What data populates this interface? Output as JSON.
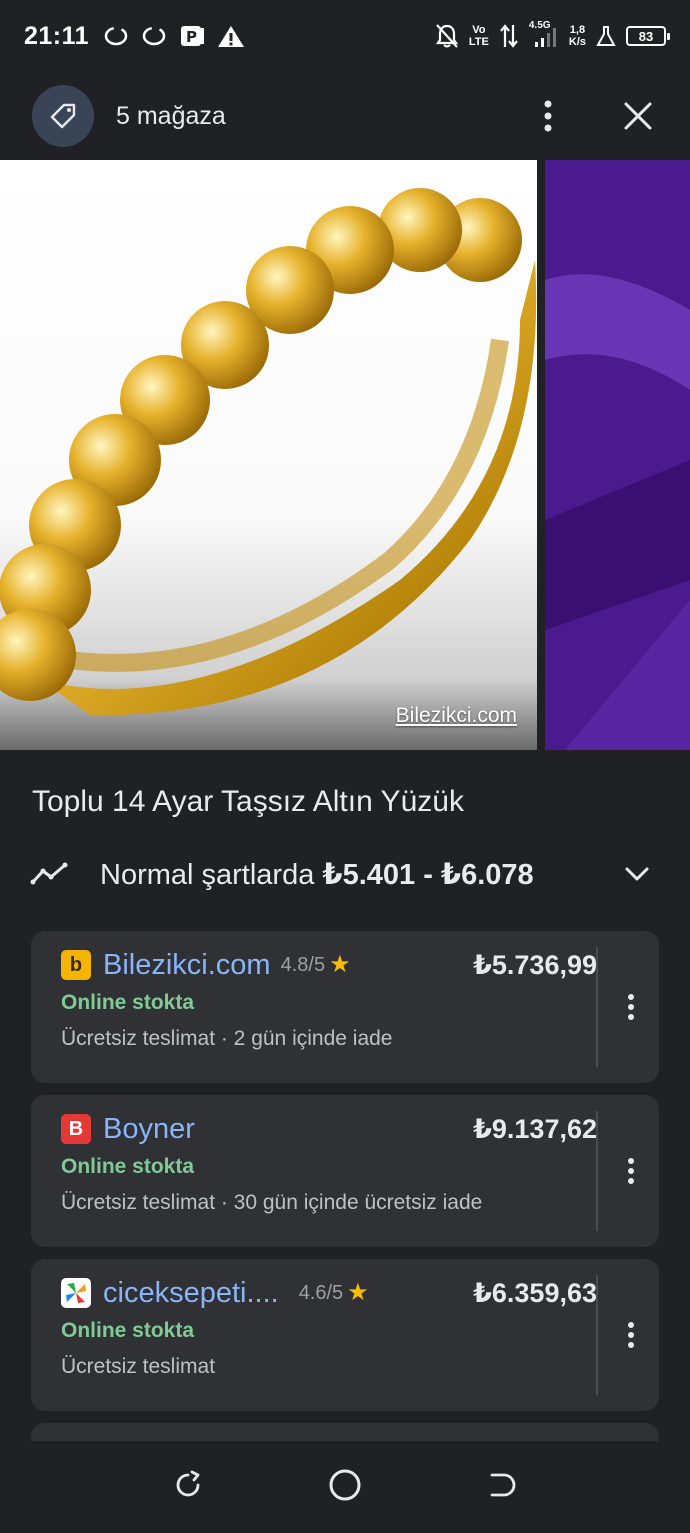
{
  "status_bar": {
    "time": "21:11",
    "net_type_top": "Vo",
    "net_type_bottom": "LTE",
    "signal_label": "4.5G",
    "speed_top": "1,8",
    "speed_bottom": "K/s",
    "battery": "83"
  },
  "header": {
    "title": "5 mağaza"
  },
  "gallery": {
    "source": "Bilezikci.com"
  },
  "product": {
    "title": "Toplu 14 Ayar Taşsız Altın Yüzük",
    "price_prefix": "Normal şartlarda",
    "price_range": "₺5.401 - ₺6.078"
  },
  "offers": [
    {
      "logo_letter": "b",
      "logo_bg": "#f4b400",
      "logo_fg": "#3c2a00",
      "store": "Bilezikci.com",
      "rating": "4.8/5",
      "price": "₺5.736,99",
      "stock": "Online stokta",
      "delivery": "Ücretsiz teslimat · 2 gün içinde iade"
    },
    {
      "logo_letter": "B",
      "logo_bg": "#e53935",
      "logo_fg": "#ffffff",
      "store": "Boyner",
      "rating": "",
      "price": "₺9.137,62",
      "stock": "Online stokta",
      "delivery": "Ücretsiz teslimat · 30 gün içinde ücretsiz iade"
    },
    {
      "logo_letter": "",
      "logo_bg": "#ffffff",
      "logo_fg": "#000000",
      "store": "ciceksepeti....",
      "rating": "4.6/5",
      "price": "₺6.359,63",
      "stock": "Online stokta",
      "delivery": "Ücretsiz teslimat"
    }
  ],
  "colors": {
    "background": "#202124",
    "card": "#303134",
    "link": "#8ab4f8",
    "stock_green": "#81c995",
    "star": "#fbbc04"
  }
}
